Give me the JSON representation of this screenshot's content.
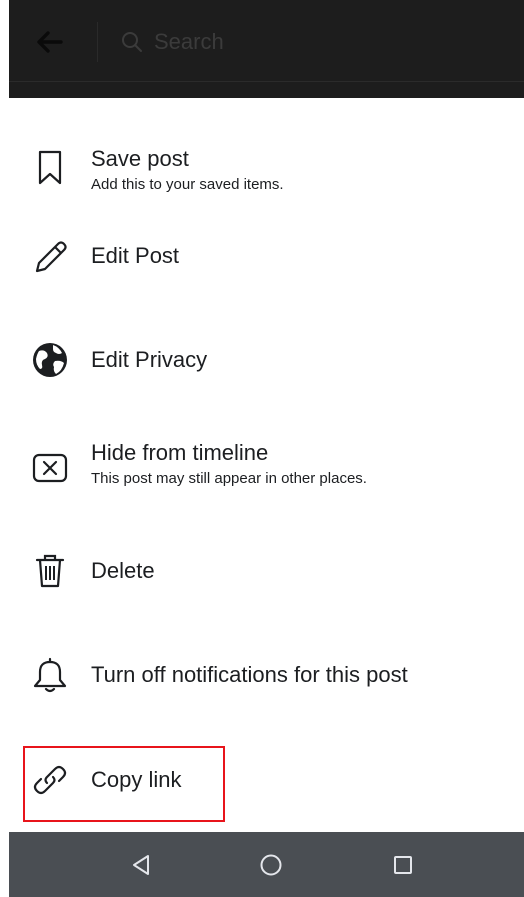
{
  "search": {
    "placeholder": "Search"
  },
  "menu": {
    "items": [
      {
        "title": "Save post",
        "subtitle": "Add this to your saved items.",
        "icon": "bookmark-icon"
      },
      {
        "title": "Edit Post",
        "subtitle": "",
        "icon": "pencil-icon"
      },
      {
        "title": "Edit Privacy",
        "subtitle": "",
        "icon": "globe-icon"
      },
      {
        "title": "Hide from timeline",
        "subtitle": "This post may still appear in other places.",
        "icon": "close-box-icon"
      },
      {
        "title": "Delete",
        "subtitle": "",
        "icon": "trash-icon"
      },
      {
        "title": "Turn off notifications for this post",
        "subtitle": "",
        "icon": "bell-icon"
      },
      {
        "title": "Copy link",
        "subtitle": "",
        "icon": "link-icon"
      }
    ]
  },
  "navbar": {
    "buttons": [
      "back-triangle-icon",
      "home-circle-icon",
      "recents-square-icon"
    ]
  },
  "colors": {
    "highlight": "#e8141b",
    "text": "#1c1e21",
    "topbar": "#1d1d1d",
    "navbar": "#4a4e53"
  }
}
